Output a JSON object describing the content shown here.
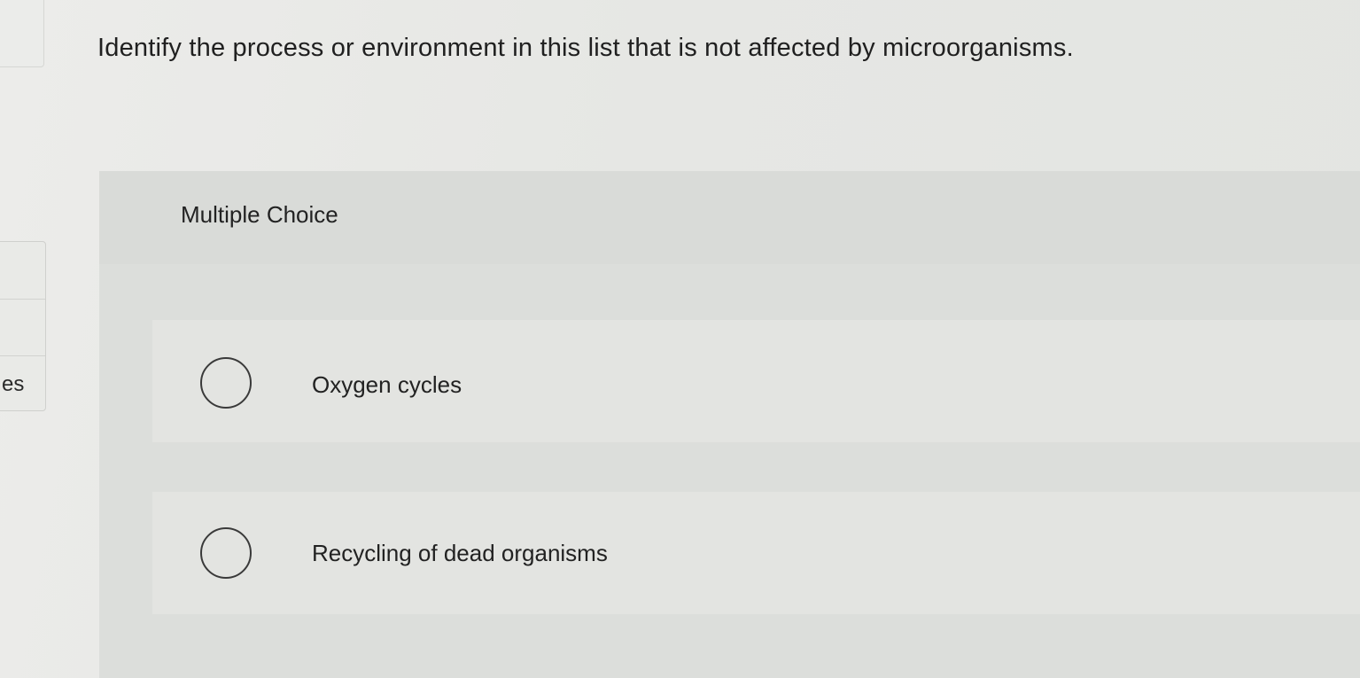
{
  "question": {
    "text": "Identify the process or environment in this list that is not affected by microorganisms."
  },
  "left_rail": {
    "label": "es"
  },
  "answer_panel": {
    "type_label": "Multiple Choice",
    "options": [
      {
        "label": "Oxygen cycles",
        "selected": false
      },
      {
        "label": "Recycling of dead organisms",
        "selected": false
      }
    ]
  }
}
